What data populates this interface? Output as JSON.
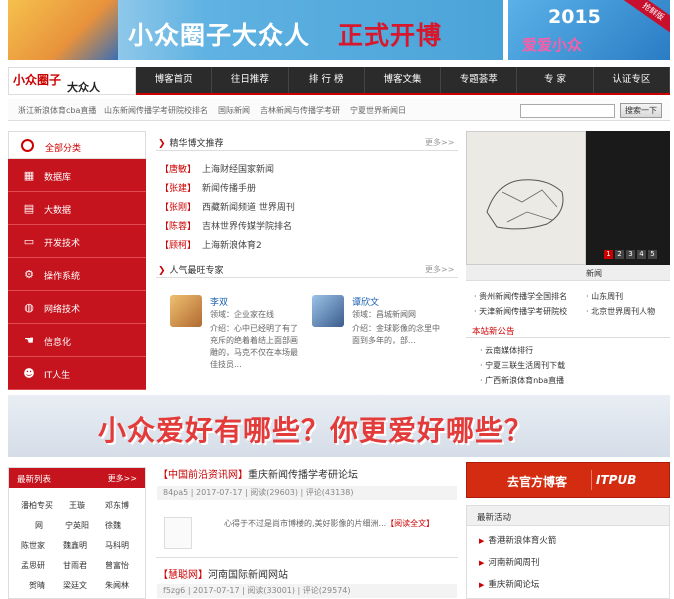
{
  "banner": {
    "headline_white": "小众圈子大众人",
    "headline_red": "正式开博",
    "side_year": "2015",
    "side_text": "爱爱小众",
    "side_corner": "抢鲜版"
  },
  "logo": {
    "line1": "小众圈子",
    "line2": "大众人"
  },
  "nav": [
    "博客首页",
    "往日推荐",
    "排 行 榜",
    "博客文集",
    "专题荟萃",
    "专 家",
    "认证专区"
  ],
  "links": [
    "浙江新浪体育cba直播",
    "山东新闻传播学考研院校排名",
    "国际新闻",
    "吉林新闻与传播学考研",
    "宁夏世界新闻日"
  ],
  "search": {
    "button": "搜索一下"
  },
  "sidebar": {
    "header": "全部分类",
    "items": [
      {
        "label": "数据库",
        "icon": "grid-icon"
      },
      {
        "label": "大数据",
        "icon": "document-icon"
      },
      {
        "label": "开发技术",
        "icon": "monitor-icon"
      },
      {
        "label": "操作系统",
        "icon": "gears-icon"
      },
      {
        "label": "网络技术",
        "icon": "globe-icon"
      },
      {
        "label": "信息化",
        "icon": "hand-icon"
      },
      {
        "label": "IT人生",
        "icon": "people-icon"
      }
    ]
  },
  "featured": {
    "title": "精华博文推荐",
    "more": "更多>>",
    "items": [
      {
        "tag": "【唐敏】",
        "title": "上海财经国家新闻"
      },
      {
        "tag": "【张建】",
        "title": "新闻传播手册"
      },
      {
        "tag": "【张刚】",
        "title": "西藏新闻频道 世界周刊"
      },
      {
        "tag": "【陈蓉】",
        "title": "吉林世界传媒学院排名"
      },
      {
        "tag": "【顾柯】",
        "title": "上海新浪体育2"
      }
    ]
  },
  "experts": {
    "title": "人气最旺专家",
    "more": "更多>>",
    "items": [
      {
        "name": "李双",
        "field": "领域：企业家在线",
        "intro": "介绍：心中已经明了有了充斥的绝着着结上面部画雕的，马克不仅在本场最佳技员..."
      },
      {
        "name": "谭欣文",
        "field": "领域：昌城新闻网",
        "intro": "介绍：金球影像的念里中面到多年的，部..."
      }
    ]
  },
  "slideshow": {
    "pages": [
      "1",
      "2",
      "3",
      "4",
      "5"
    ],
    "caption": "新闻",
    "links_left": [
      "· 贵州新闻传播学全国排名",
      "· 天津新闻传播学考研院校"
    ],
    "links_right": [
      "· 山东周刊",
      "· 北京世界周刊人物"
    ]
  },
  "recent_notice": {
    "title": "本站新公告",
    "items": [
      "· 云南媒体排行",
      "· 宁夏三联生活周刊下载",
      "· 广西新浪体育nba直播"
    ]
  },
  "big_banner": {
    "text": "小众爱好有哪些？你更爱好哪些？"
  },
  "new_list": {
    "title": "最新列表",
    "more": "更多>>",
    "rows": [
      [
        "潘柏专买",
        "王璇",
        "邓东博"
      ],
      [
        "网",
        "宁英阳",
        "徐魏"
      ],
      [
        "陈世家",
        "魏鑫明",
        "马科明"
      ],
      [
        "孟思研",
        "甘雨君",
        "曾富怡"
      ],
      [
        "贺晴",
        "梁廷文",
        "朱闻林"
      ]
    ]
  },
  "posts": [
    {
      "tag": "【中国前沿资讯网】",
      "title": "重庆新闻传播学考研论坛",
      "meta": "84pa5 | 2017-07-17 | 阅读(29603) | 评论(43138)"
    },
    {
      "tag": "【慧聪网】",
      "title": "河南国际新闻网站",
      "meta": "f5zg6 | 2017-07-17 | 阅读(33001) | 评论(29574)"
    }
  ],
  "excerpt": {
    "text": "心得于不过是尚市博楼的,美好影像的片细洲...",
    "link": "【阅读全文】"
  },
  "official": {
    "text": "去官方博客",
    "logo": "ITPUB"
  },
  "activity": {
    "title": "最新活动",
    "items": [
      "香港新浪体育火箭",
      "河南新闻周刊",
      "重庆新闻论坛"
    ]
  },
  "colors": {
    "accent": "#c6141e",
    "nav_bg": "#2b2b2b",
    "link": "#1a5fb4"
  }
}
